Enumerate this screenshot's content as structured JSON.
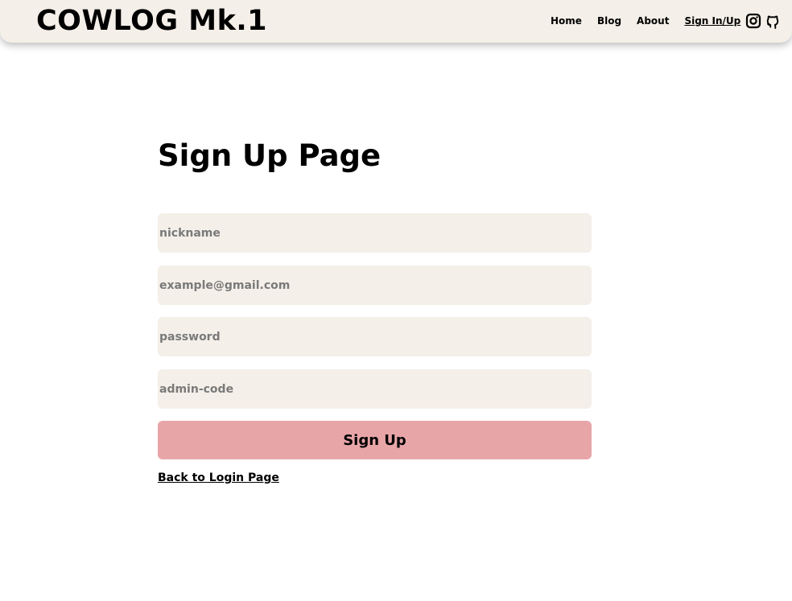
{
  "header": {
    "brand": "COWLOG Mk.1",
    "nav": [
      {
        "label": "Home"
      },
      {
        "label": "Blog"
      },
      {
        "label": "About"
      },
      {
        "label": "Sign In/Up"
      }
    ],
    "icons": [
      "instagram-icon",
      "github-icon"
    ]
  },
  "main": {
    "title": "Sign Up Page",
    "fields": {
      "nickname": {
        "placeholder": "nickname",
        "value": ""
      },
      "email": {
        "placeholder": "example@gmail.com",
        "value": ""
      },
      "password": {
        "placeholder": "password",
        "value": ""
      },
      "admin_code": {
        "placeholder": "admin-code",
        "value": ""
      }
    },
    "submit_label": "Sign Up",
    "back_link": "Back to Login Page"
  },
  "colors": {
    "header_bg": "#f4efe8",
    "input_bg": "#f4efe8",
    "button_bg": "#e8a5a8"
  }
}
